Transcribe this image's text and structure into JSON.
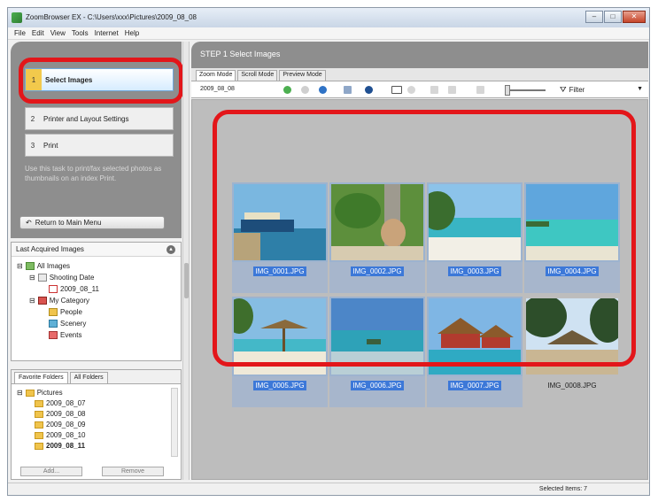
{
  "window": {
    "title": "ZoomBrowser EX - C:\\Users\\xxx\\Pictures\\2009_08_08"
  },
  "menubar": [
    "File",
    "Edit",
    "View",
    "Tools",
    "Internet",
    "Help"
  ],
  "steps": [
    {
      "num": "1",
      "label": "Select Images"
    },
    {
      "num": "2",
      "label": "Printer and Layout Settings"
    },
    {
      "num": "3",
      "label": "Print"
    }
  ],
  "hint": "Use this task to print/fax selected photos as thumbnails on an index Print.",
  "return_label": "Return to Main Menu",
  "last_acquired": {
    "title": "Last Acquired Images",
    "tree": [
      "All Images",
      "Shooting Date",
      "2009_08_11",
      "My Category",
      "People",
      "Scenery",
      "Events"
    ]
  },
  "folders": {
    "tabs": [
      "Favorite Folders",
      "All Folders"
    ],
    "items": [
      "Pictures",
      "2009_08_07",
      "2009_08_08",
      "2009_08_09",
      "2009_08_10",
      "2009_08_11"
    ],
    "add_label": "Add...",
    "remove_label": "Remove"
  },
  "right": {
    "step_title": "STEP 1  Select Images",
    "mode_tabs": [
      "Zoom Mode",
      "Scroll Mode",
      "Preview Mode"
    ],
    "path": "2009_08_08",
    "filter_label": "Filter"
  },
  "thumbnails": [
    {
      "name": "IMG_0001.JPG",
      "selected": true
    },
    {
      "name": "IMG_0002.JPG",
      "selected": true
    },
    {
      "name": "IMG_0003.JPG",
      "selected": true
    },
    {
      "name": "IMG_0004.JPG",
      "selected": true
    },
    {
      "name": "IMG_0005.JPG",
      "selected": true
    },
    {
      "name": "IMG_0006.JPG",
      "selected": true
    },
    {
      "name": "IMG_0007.JPG",
      "selected": true
    },
    {
      "name": "IMG_0008.JPG",
      "selected": false
    }
  ],
  "status": "Selected Items: 7"
}
